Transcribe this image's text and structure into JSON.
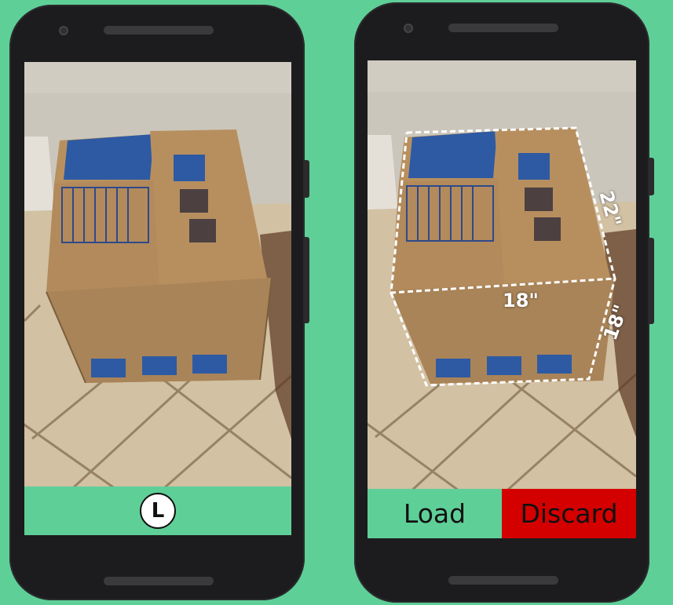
{
  "colors": {
    "background": "#5fcf98",
    "phone_body": "#1c1c1e",
    "load_button": "#5fcf98",
    "discard_button": "#d40000"
  },
  "left_phone": {
    "capture_button_label": "L"
  },
  "right_phone": {
    "buttons": {
      "load": "Load",
      "discard": "Discard"
    },
    "dimensions": {
      "depth": "22\"",
      "width": "18\"",
      "height": "18\""
    }
  }
}
